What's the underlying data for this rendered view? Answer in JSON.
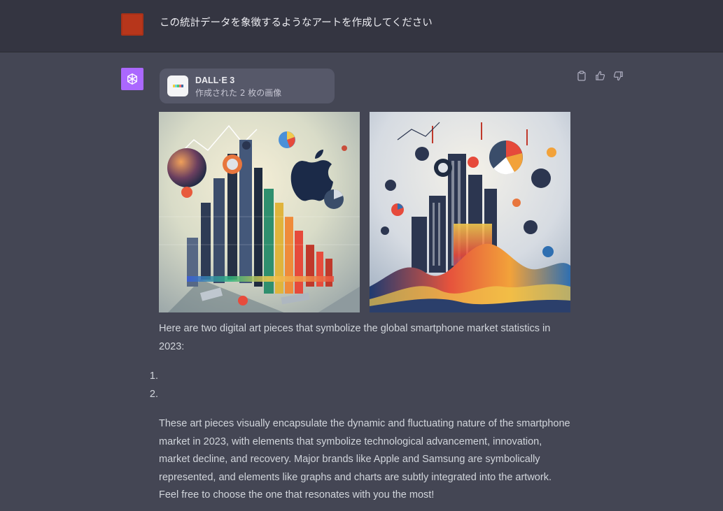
{
  "user_message": {
    "text": "この統計データを象徴するようなアートを作成してください",
    "avatar_color": "#b7361b"
  },
  "assistant": {
    "avatar_color": "#ab68ff",
    "avatar_icon": "openai-logo-icon",
    "tool": {
      "name": "DALL·E 3",
      "subtitle": "作成された 2 枚の画像",
      "icon": "dalle-icon"
    },
    "actions": [
      {
        "name": "copy",
        "icon": "clipboard-icon"
      },
      {
        "name": "thumbs-up",
        "icon": "thumbs-up-icon"
      },
      {
        "name": "thumbs-down",
        "icon": "thumbs-down-icon"
      }
    ],
    "images": [
      {
        "name": "generated-image-1"
      },
      {
        "name": "generated-image-2"
      }
    ],
    "intro": "Here are two digital art pieces that symbolize the global smartphone market statistics in 2023:",
    "list_items": [
      {
        "number": "1.",
        "text": ""
      },
      {
        "number": "2.",
        "text": ""
      }
    ],
    "body": "These art pieces visually encapsulate the dynamic and fluctuating nature of the smartphone market in 2023, with elements that symbolize technological advancement, innovation, market decline, and recovery. Major brands like Apple and Samsung are symbolically represented, and elements like graphs and charts are subtly integrated into the artwork. Feel free to choose the one that resonates with you the most!"
  }
}
